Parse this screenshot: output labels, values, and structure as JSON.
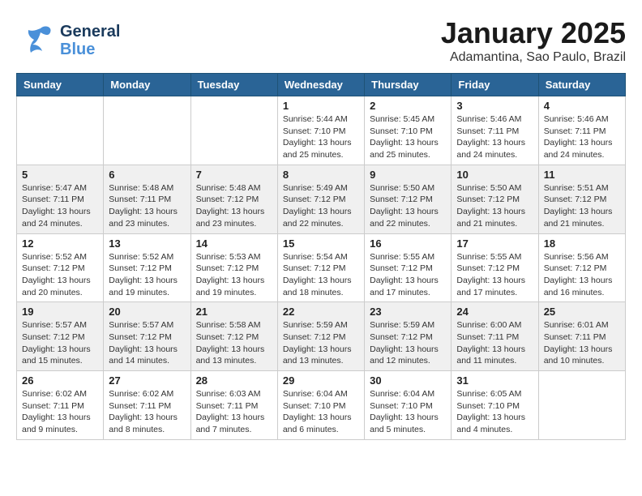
{
  "header": {
    "logo_general": "General",
    "logo_blue": "Blue",
    "month_title": "January 2025",
    "location": "Adamantina, Sao Paulo, Brazil"
  },
  "days_of_week": [
    "Sunday",
    "Monday",
    "Tuesday",
    "Wednesday",
    "Thursday",
    "Friday",
    "Saturday"
  ],
  "weeks": [
    [
      {
        "day": "",
        "info": ""
      },
      {
        "day": "",
        "info": ""
      },
      {
        "day": "",
        "info": ""
      },
      {
        "day": "1",
        "info": "Sunrise: 5:44 AM\nSunset: 7:10 PM\nDaylight: 13 hours\nand 25 minutes."
      },
      {
        "day": "2",
        "info": "Sunrise: 5:45 AM\nSunset: 7:10 PM\nDaylight: 13 hours\nand 25 minutes."
      },
      {
        "day": "3",
        "info": "Sunrise: 5:46 AM\nSunset: 7:11 PM\nDaylight: 13 hours\nand 24 minutes."
      },
      {
        "day": "4",
        "info": "Sunrise: 5:46 AM\nSunset: 7:11 PM\nDaylight: 13 hours\nand 24 minutes."
      }
    ],
    [
      {
        "day": "5",
        "info": "Sunrise: 5:47 AM\nSunset: 7:11 PM\nDaylight: 13 hours\nand 24 minutes."
      },
      {
        "day": "6",
        "info": "Sunrise: 5:48 AM\nSunset: 7:11 PM\nDaylight: 13 hours\nand 23 minutes."
      },
      {
        "day": "7",
        "info": "Sunrise: 5:48 AM\nSunset: 7:12 PM\nDaylight: 13 hours\nand 23 minutes."
      },
      {
        "day": "8",
        "info": "Sunrise: 5:49 AM\nSunset: 7:12 PM\nDaylight: 13 hours\nand 22 minutes."
      },
      {
        "day": "9",
        "info": "Sunrise: 5:50 AM\nSunset: 7:12 PM\nDaylight: 13 hours\nand 22 minutes."
      },
      {
        "day": "10",
        "info": "Sunrise: 5:50 AM\nSunset: 7:12 PM\nDaylight: 13 hours\nand 21 minutes."
      },
      {
        "day": "11",
        "info": "Sunrise: 5:51 AM\nSunset: 7:12 PM\nDaylight: 13 hours\nand 21 minutes."
      }
    ],
    [
      {
        "day": "12",
        "info": "Sunrise: 5:52 AM\nSunset: 7:12 PM\nDaylight: 13 hours\nand 20 minutes."
      },
      {
        "day": "13",
        "info": "Sunrise: 5:52 AM\nSunset: 7:12 PM\nDaylight: 13 hours\nand 19 minutes."
      },
      {
        "day": "14",
        "info": "Sunrise: 5:53 AM\nSunset: 7:12 PM\nDaylight: 13 hours\nand 19 minutes."
      },
      {
        "day": "15",
        "info": "Sunrise: 5:54 AM\nSunset: 7:12 PM\nDaylight: 13 hours\nand 18 minutes."
      },
      {
        "day": "16",
        "info": "Sunrise: 5:55 AM\nSunset: 7:12 PM\nDaylight: 13 hours\nand 17 minutes."
      },
      {
        "day": "17",
        "info": "Sunrise: 5:55 AM\nSunset: 7:12 PM\nDaylight: 13 hours\nand 17 minutes."
      },
      {
        "day": "18",
        "info": "Sunrise: 5:56 AM\nSunset: 7:12 PM\nDaylight: 13 hours\nand 16 minutes."
      }
    ],
    [
      {
        "day": "19",
        "info": "Sunrise: 5:57 AM\nSunset: 7:12 PM\nDaylight: 13 hours\nand 15 minutes."
      },
      {
        "day": "20",
        "info": "Sunrise: 5:57 AM\nSunset: 7:12 PM\nDaylight: 13 hours\nand 14 minutes."
      },
      {
        "day": "21",
        "info": "Sunrise: 5:58 AM\nSunset: 7:12 PM\nDaylight: 13 hours\nand 13 minutes."
      },
      {
        "day": "22",
        "info": "Sunrise: 5:59 AM\nSunset: 7:12 PM\nDaylight: 13 hours\nand 13 minutes."
      },
      {
        "day": "23",
        "info": "Sunrise: 5:59 AM\nSunset: 7:12 PM\nDaylight: 13 hours\nand 12 minutes."
      },
      {
        "day": "24",
        "info": "Sunrise: 6:00 AM\nSunset: 7:11 PM\nDaylight: 13 hours\nand 11 minutes."
      },
      {
        "day": "25",
        "info": "Sunrise: 6:01 AM\nSunset: 7:11 PM\nDaylight: 13 hours\nand 10 minutes."
      }
    ],
    [
      {
        "day": "26",
        "info": "Sunrise: 6:02 AM\nSunset: 7:11 PM\nDaylight: 13 hours\nand 9 minutes."
      },
      {
        "day": "27",
        "info": "Sunrise: 6:02 AM\nSunset: 7:11 PM\nDaylight: 13 hours\nand 8 minutes."
      },
      {
        "day": "28",
        "info": "Sunrise: 6:03 AM\nSunset: 7:11 PM\nDaylight: 13 hours\nand 7 minutes."
      },
      {
        "day": "29",
        "info": "Sunrise: 6:04 AM\nSunset: 7:10 PM\nDaylight: 13 hours\nand 6 minutes."
      },
      {
        "day": "30",
        "info": "Sunrise: 6:04 AM\nSunset: 7:10 PM\nDaylight: 13 hours\nand 5 minutes."
      },
      {
        "day": "31",
        "info": "Sunrise: 6:05 AM\nSunset: 7:10 PM\nDaylight: 13 hours\nand 4 minutes."
      },
      {
        "day": "",
        "info": ""
      }
    ]
  ]
}
